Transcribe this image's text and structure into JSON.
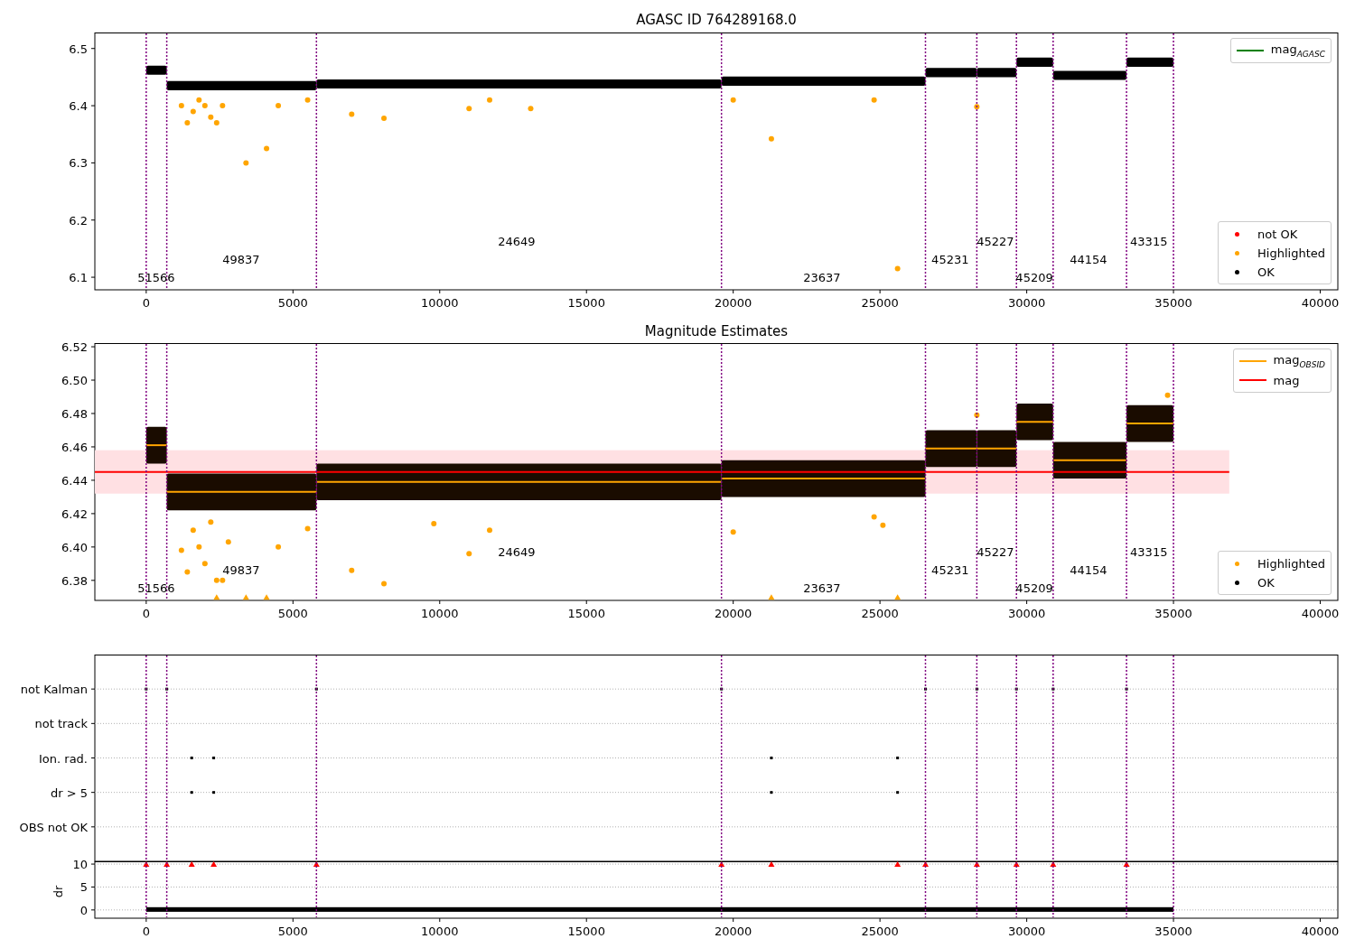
{
  "panels": [
    {
      "kind": "mag",
      "chart_data": {
        "type": "scatter",
        "title": "AGASC ID 764289168.0",
        "xlim": [
          -1750,
          40600
        ],
        "ylim": [
          6.078,
          6.528
        ],
        "xticks": [
          0,
          5000,
          10000,
          15000,
          20000,
          25000,
          30000,
          35000,
          40000
        ],
        "yticks": [
          {
            "value": 6.1,
            "label": "6.1"
          },
          {
            "value": 6.2,
            "label": "6.2"
          },
          {
            "value": 6.3,
            "label": "6.3"
          },
          {
            "value": 6.4,
            "label": "6.4"
          },
          {
            "value": 6.5,
            "label": "6.5"
          }
        ],
        "x": [
          1200,
          1400,
          1600,
          1800,
          2000,
          2200,
          2400,
          2600,
          3400,
          4100,
          4500,
          5500,
          7000,
          8100,
          11000,
          11700,
          13100,
          20000,
          21300,
          24800,
          25600,
          28300
        ],
        "series": [
          {
            "color": "#ffa500",
            "marker": "circle",
            "values": [
              6.4,
              6.37,
              6.39,
              6.41,
              6.4,
              6.38,
              6.37,
              6.4,
              6.3,
              6.325,
              6.4,
              6.41,
              6.385,
              6.378,
              6.395,
              6.41,
              6.395,
              6.41,
              6.342,
              6.41,
              6.115,
              6.398
            ]
          }
        ],
        "annotations": [
          "51566",
          "49837",
          "24649",
          "23637",
          "45231",
          "45227",
          "45209",
          "44154",
          "43315"
        ]
      },
      "legends": [
        {
          "entries": [
            {
              "kind": "line",
              "label": "mag$_{AGASC}$",
              "color": "#008000"
            }
          ]
        },
        {
          "entries": [
            {
              "kind": "dot",
              "label": "not OK",
              "color": "#ff0000"
            },
            {
              "kind": "dot",
              "label": "Highlighted",
              "color": "#ffa500"
            },
            {
              "kind": "dot",
              "label": "OK",
              "color": "#000000"
            }
          ]
        }
      ]
    },
    {
      "kind": "estimates",
      "chart_data": {
        "type": "scatter",
        "title": "Magnitude Estimates",
        "xlim": [
          -1750,
          40600
        ],
        "ylim": [
          6.368,
          6.5222
        ],
        "xticks": [
          0,
          5000,
          10000,
          15000,
          20000,
          25000,
          30000,
          35000,
          40000
        ],
        "yticks": [
          {
            "value": 6.38,
            "label": "6.38"
          },
          {
            "value": 6.4,
            "label": "6.40"
          },
          {
            "value": 6.42,
            "label": "6.42"
          },
          {
            "value": 6.44,
            "label": "6.44"
          },
          {
            "value": 6.46,
            "label": "6.46"
          },
          {
            "value": 6.48,
            "label": "6.48"
          },
          {
            "value": 6.5,
            "label": "6.50"
          },
          {
            "value": 6.52,
            "label": "6.52"
          }
        ],
        "x": [
          1200,
          1400,
          1600,
          1800,
          2000,
          2200,
          2400,
          2600,
          2800,
          4500,
          5500,
          7000,
          8100,
          9800,
          11000,
          11700,
          20000,
          24800,
          25100,
          28300,
          34800,
          2400,
          3400,
          4100,
          21300,
          25600
        ],
        "series": [
          {
            "color": "#ffa500",
            "marker": "circle",
            "values": [
              6.398,
              6.385,
              6.41,
              6.4,
              6.39,
              6.415,
              6.38,
              6.38,
              6.403,
              6.4,
              6.411,
              6.386,
              6.378,
              6.414,
              6.396,
              6.41,
              6.409,
              6.418,
              6.413,
              6.479,
              6.491,
              null,
              null,
              null,
              null,
              null
            ]
          },
          {
            "color": "#ffa500",
            "marker": "triangle",
            "values": [
              null,
              null,
              null,
              null,
              null,
              null,
              null,
              null,
              null,
              null,
              null,
              null,
              null,
              null,
              null,
              null,
              null,
              null,
              null,
              null,
              null,
              6.37,
              6.37,
              6.37,
              6.37,
              6.37
            ]
          }
        ],
        "bands": [
          {
            "axis": "y",
            "from": 6.432,
            "to": 6.458,
            "color": "#ffe0e3"
          }
        ],
        "ref_lines": [
          {
            "axis": "y",
            "value": 6.445,
            "color": "#ff0000"
          }
        ],
        "annotations": [
          "51566",
          "49837",
          "24649",
          "23637",
          "45231",
          "45227",
          "45209",
          "44154",
          "43315"
        ]
      },
      "legends": [
        {
          "entries": [
            {
              "kind": "line",
              "label": "mag$_{OBSID}$",
              "color": "#ffa500"
            },
            {
              "kind": "line",
              "label": "mag",
              "color": "#ff0000"
            }
          ]
        },
        {
          "entries": [
            {
              "kind": "dot",
              "label": "Highlighted",
              "color": "#ffa500"
            },
            {
              "kind": "dot",
              "label": "OK",
              "color": "#000000"
            }
          ]
        }
      ]
    },
    {
      "kind": "flags",
      "chart_data": {
        "type": "scatter",
        "xlim": [
          -1750,
          40600
        ],
        "grid": true,
        "orientation": "horizontal",
        "categories": [
          "not Kalman",
          "not track",
          "Ion. rad.",
          "dr > 5",
          "OBS not OK"
        ]
      }
    },
    {
      "kind": "dr",
      "chart_data": {
        "type": "scatter",
        "ylabel": "dr",
        "grid": true,
        "xlim": [
          -1750,
          40600
        ],
        "ylim": [
          -1.8,
          10.6
        ],
        "xticks": [
          0,
          5000,
          10000,
          15000,
          20000,
          25000,
          30000,
          35000,
          40000
        ],
        "yticks": [
          0,
          5,
          10
        ],
        "x": [
          0,
          700,
          1550,
          2300,
          5800,
          19600,
          21300,
          25600,
          26550,
          28300,
          29650,
          30900,
          33400
        ],
        "series": [
          {
            "color": "#ff0000",
            "marker": "triangle",
            "values": [
              10,
              10,
              10,
              10,
              10,
              10,
              10,
              10,
              10,
              10,
              10,
              10,
              10
            ]
          }
        ]
      }
    }
  ]
}
